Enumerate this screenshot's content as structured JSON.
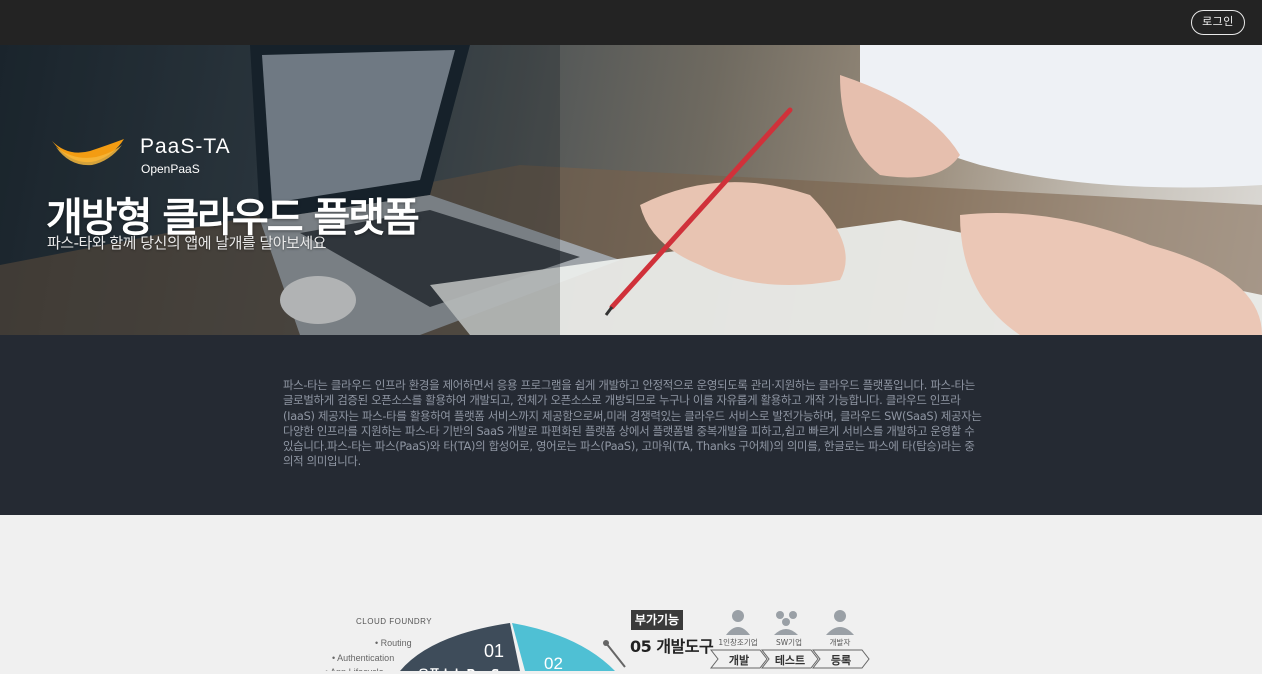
{
  "header": {
    "login_label": "로그인"
  },
  "hero": {
    "brand_name": "PaaS-TA",
    "brand_sub": "OpenPaaS",
    "title": "개방형 클라우드 플랫폼",
    "subtitle": "파스-타와 함께 당신의 앱에 날개를 달아보세요"
  },
  "intro": {
    "text": "파스-타는 클라우드 인프라 환경을 제어하면서 응용 프로그램을 쉽게 개발하고 안정적으로 운영되도록 관리·지원하는 클라우드 플랫폼입니다. 파스-타는 글로벌하게 검증된 오픈소스를 활용하여 개발되고, 전체가 오픈소스로 개방되므로 누구나 이를 자유롭게 활용하고 개작 가능합니다. 클라우드 인프라(IaaS) 제공자는 파스-타를 활용하여 플랫폼 서비스까지 제공함으로써,미래 경쟁력있는 클라우드 서비스로 발전가능하며, 클라우드 SW(SaaS) 제공자는 다양한 인프라를 지원하는 파스-타 기반의 SaaS 개발로 파편화된 플랫폼 상에서 플랫폼별 중복개발을 피하고,쉽고 빠르게 서비스를 개발하고 운영할 수 있습니다.파스-타는 파스(PaaS)와 타(TA)의 합성어로, 영어로는 파스(PaaS), 고마워(TA, Thanks 구어체)의 의미를, 한글로는 파스에 타(탑승)라는 중의적 의미입니다."
  },
  "diagram": {
    "cf_logo": "CLOUD FOUNDRY",
    "cf_items": [
      "• Routing",
      "• Authentication",
      "• App Lifecycle"
    ],
    "seg1_num": "01",
    "seg1_label": "오픈소스 PaaS",
    "seg2_num": "02",
    "badge": "부가기능",
    "tool_title": "05  개발도구",
    "roles": [
      "1인창조기업",
      "SW기업",
      "개발자"
    ],
    "steps": [
      "개발",
      "테스트",
      "등록"
    ],
    "colors": {
      "dark_segment": "#3e4c5a",
      "teal_segment": "#4fc0d4"
    }
  }
}
